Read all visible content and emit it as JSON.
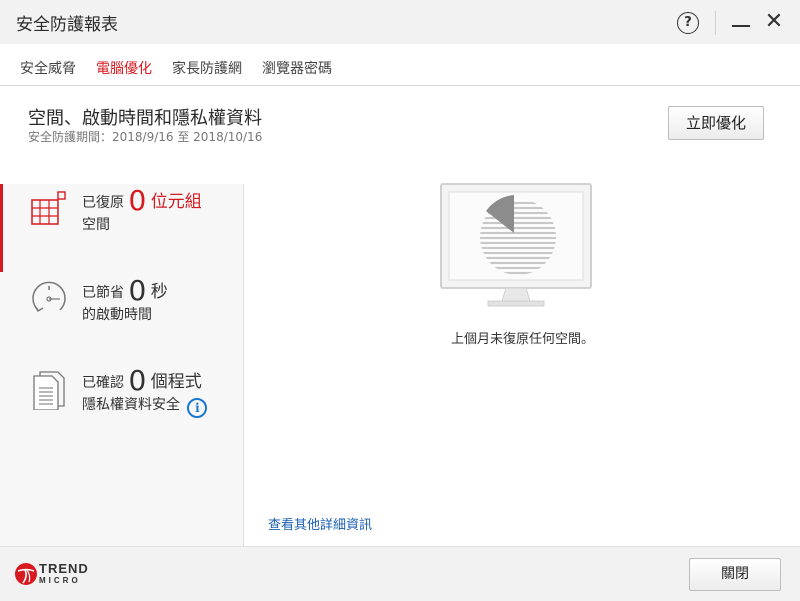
{
  "window": {
    "title": "安全防護報表",
    "help_symbol": "?",
    "close_symbol": "✕"
  },
  "tabs": [
    {
      "label": "安全威脅",
      "active": false
    },
    {
      "label": "電腦優化",
      "active": true
    },
    {
      "label": "家長防護網",
      "active": false
    },
    {
      "label": "瀏覽器密碼",
      "active": false
    }
  ],
  "header": {
    "title": "空間、啟動時間和隱私權資料",
    "period": "安全防護期間：2018/9/16 至 2018/10/16",
    "optimize_button": "立即優化"
  },
  "stats": [
    {
      "prefix": "已復原",
      "value": "0",
      "unit": "位元組",
      "line2": "空間",
      "icon": "grid-space-icon",
      "active": true
    },
    {
      "prefix": "已節省",
      "value": "0",
      "unit": "秒",
      "line2": "的啟動時間",
      "icon": "clock-icon",
      "active": false
    },
    {
      "prefix": "已確認",
      "value": "0",
      "unit": "個程式",
      "line2": "隱私權資料安全",
      "icon": "document-icon",
      "active": false,
      "info_symbol": "i"
    }
  ],
  "main": {
    "empty_message": "上個月未復原任何空間。",
    "more_link": "查看其他詳細資訊"
  },
  "footer": {
    "logo_line1": "TREND",
    "logo_line2": "MICRO",
    "close_button": "關閉"
  },
  "colors": {
    "accent": "#d71920",
    "link": "#1a5fb4",
    "info": "#1976d2"
  }
}
